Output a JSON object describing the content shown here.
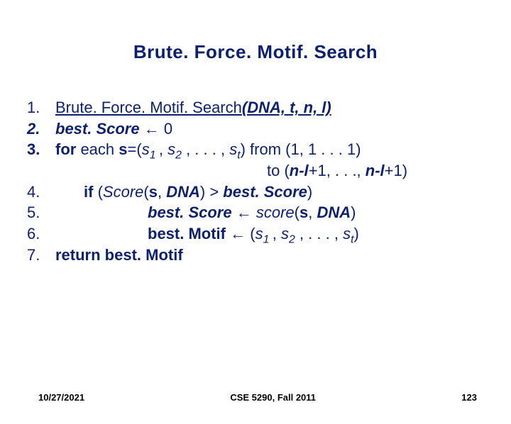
{
  "title": "Brute. Force. Motif. Search",
  "lines": {
    "n1": "1.",
    "l1a": "Brute. Force. Motif. Search",
    "l1b": "(DNA, t, n, l)",
    "n2": "2.",
    "l2a": "best. Score",
    "l2b": " ← 0",
    "n3": "3.",
    "l3a": "for",
    "l3b": " each ",
    "l3c": "s",
    "l3d": "=(",
    "l3e": "s",
    "l3e_sub": "1 ",
    "l3f": ", ",
    "l3g": "s",
    "l3g_sub": "2",
    "l3h": " , . . . , ",
    "l3i": "s",
    "l3i_sub": "t",
    "l3j": ") from (1, 1 . . . 1)",
    "l3k": "to (",
    "l3l": "n-l",
    "l3m": "+1, . . ., ",
    "l3n": "n-l",
    "l3o": "+1)",
    "n4": "4.",
    "l4a": "if",
    "l4b": " (",
    "l4c": "Score",
    "l4d": "(",
    "l4e": "s",
    "l4f": ", ",
    "l4g": "DNA",
    "l4h": ") > ",
    "l4i": "best. Score",
    "l4j": ")",
    "n5": "5.",
    "l5a": "best. Score",
    "l5b": " ← ",
    "l5c": "score",
    "l5d": "(",
    "l5e": "s",
    "l5f": ", ",
    "l5g": "DNA",
    "l5h": ")",
    "n6": "6.",
    "l6a": "best. Motif",
    "l6b": " ← (",
    "l6c": "s",
    "l6c_sub": "1 ",
    "l6d": ", ",
    "l6e": "s",
    "l6e_sub": "2",
    "l6f": " , . . . , ",
    "l6g": "s",
    "l6g_sub": "t",
    "l6h": ")",
    "n7": "7.",
    "l7a": "return",
    "l7b": " best. Motif"
  },
  "footer": {
    "date": "10/27/2021",
    "course": "CSE 5290, Fall 2011",
    "page": "123"
  }
}
